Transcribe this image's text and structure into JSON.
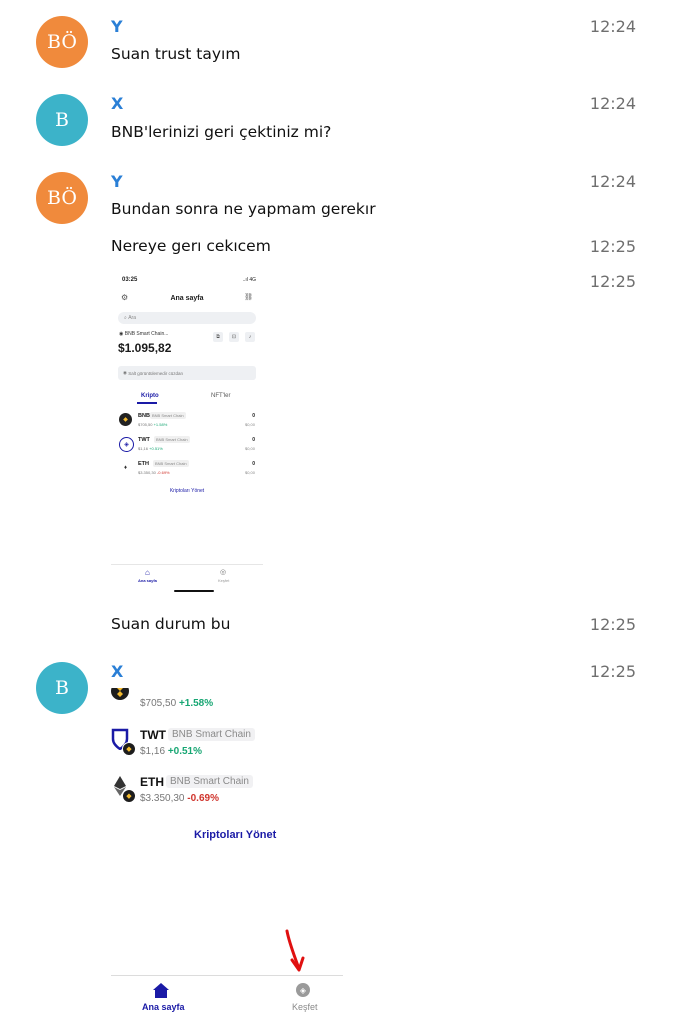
{
  "messages": [
    {
      "avatar": "BÖ",
      "avatar_color": "#f08a3c",
      "sender": "Y",
      "time": "12:24",
      "text": "Suan trust tayım"
    },
    {
      "avatar": "B",
      "avatar_color": "#3cb3c9",
      "sender": "X",
      "time": "12:24",
      "text": "BNB'lerinizi geri çektiniz mi?"
    },
    {
      "avatar": "BÖ",
      "avatar_color": "#f08a3c",
      "sender": "Y",
      "time": "12:24",
      "text": "Bundan sonra ne yapmam gerekır"
    }
  ],
  "followups": [
    {
      "time": "12:25",
      "text": "Nereye gerı cekıcem"
    },
    {
      "time": "12:25",
      "text": ""
    },
    {
      "time": "12:25",
      "text": "Suan durum bu"
    }
  ],
  "last_message": {
    "avatar": "B",
    "avatar_color": "#3cb3c9",
    "sender": "X",
    "time": "12:25"
  },
  "phone": {
    "status_time": "03:25",
    "status_icons": "..ıl 4G",
    "title": "Ana sayfa",
    "search_placeholder": "Ara",
    "wallet_name": "BNB Smart Chain...",
    "balance": "$1.095,82",
    "show_text": "Salt görüntülemedir cüzdan",
    "tab_crypto": "Kripto",
    "tab_nft": "NFT'ler",
    "tokens": [
      {
        "symbol": "BNB",
        "chain": "BNB Smart Chain",
        "price": "$705,50",
        "change": "+1.58%",
        "amount": "0",
        "usd": "$0,00"
      },
      {
        "symbol": "TWT",
        "chain": "BNB Smart Chain",
        "price": "$1,16",
        "change": "+0.51%",
        "amount": "0",
        "usd": "$0,00"
      },
      {
        "symbol": "ETH",
        "chain": "BNB Smart Chain",
        "price": "$3.350,30",
        "change": "-0.69%",
        "amount": "0",
        "usd": "$0,00"
      }
    ],
    "manage": "Kriptoları Yönet",
    "nav_home": "Ana sayfa",
    "nav_discover": "Keşfet"
  },
  "crop": {
    "tokens": [
      {
        "symbol": "BNB",
        "chain": "BNB Smart Chain",
        "price": "$705,50",
        "change": "+1.58%"
      },
      {
        "symbol": "TWT",
        "chain": "BNB Smart Chain",
        "price": "$1,16",
        "change": "+0.51%"
      },
      {
        "symbol": "ETH",
        "chain": "BNB Smart Chain",
        "price": "$3.350,30",
        "change": "-0.69%"
      }
    ],
    "manage": "Kriptoları Yönet",
    "nav_home": "Ana sayfa",
    "nav_discover": "Keşfet"
  },
  "colors": {
    "sender": "#2a7fd6",
    "accent": "#1a1aa6",
    "up": "#17a673",
    "down": "#d0342c",
    "arrow": "#e01010"
  }
}
